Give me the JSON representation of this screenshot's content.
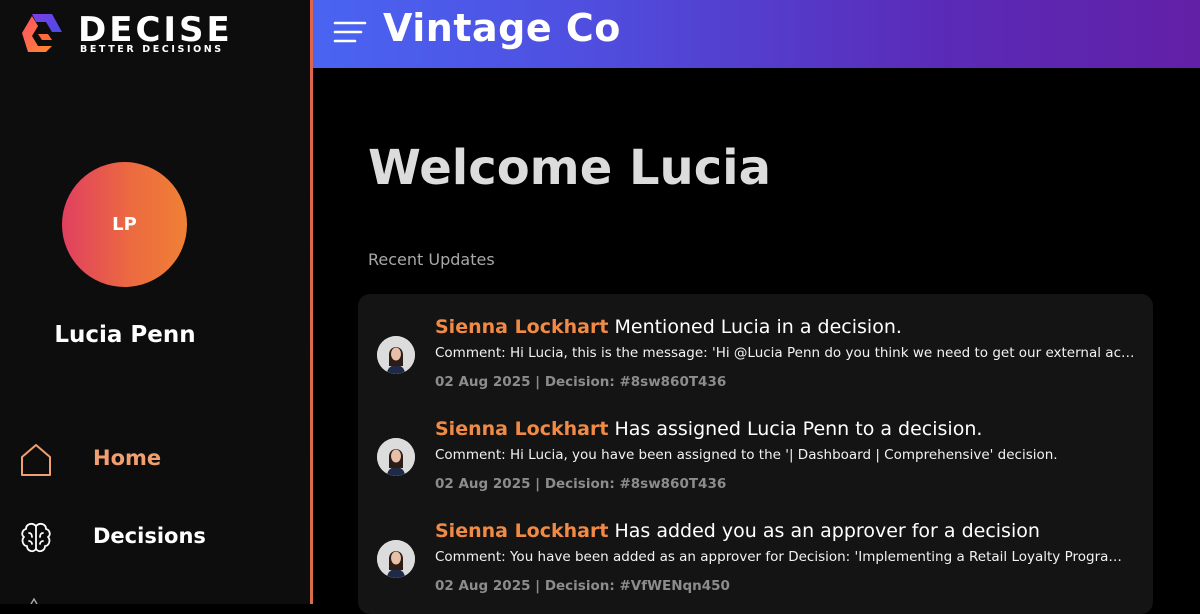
{
  "brand": {
    "wordmark": "DECISE",
    "tagline": "BETTER DECISIONS"
  },
  "header": {
    "title": "Vintage Co"
  },
  "user": {
    "initials": "LP",
    "name": "Lucia Penn"
  },
  "nav": {
    "items": [
      {
        "label": "Home",
        "icon": "home-icon",
        "active": true
      },
      {
        "label": "Decisions",
        "icon": "brain-icon",
        "active": false
      }
    ]
  },
  "main": {
    "welcome": "Welcome Lucia",
    "section_label": "Recent Updates",
    "updates": [
      {
        "actor": "Sienna Lockhart",
        "action": "Mentioned Lucia in a decision.",
        "comment": "Comment: Hi Lucia, this is the message: 'Hi @Lucia Penn do you think we need to get our external accountants involved?'",
        "meta": "02 Aug 2025 | Decision: #8sw860T436"
      },
      {
        "actor": "Sienna Lockhart",
        "action": "Has assigned Lucia Penn to a decision.",
        "comment": "Comment: Hi Lucia, you have been assigned to the '| Dashboard | Comprehensive' decision.",
        "meta": "02 Aug 2025 | Decision: #8sw860T436"
      },
      {
        "actor": "Sienna Lockhart",
        "action": "Has added you as an approver for a decision",
        "comment": "Comment: You have been added as an approver for Decision: 'Implementing a Retail Loyalty Program for Vintage Co'",
        "meta": "02 Aug 2025 | Decision: #VfWENqn450"
      }
    ]
  },
  "colors": {
    "accent_orange": "#f08a45",
    "header_gradient_start": "#4a64f2",
    "header_gradient_end": "#6220a6"
  }
}
